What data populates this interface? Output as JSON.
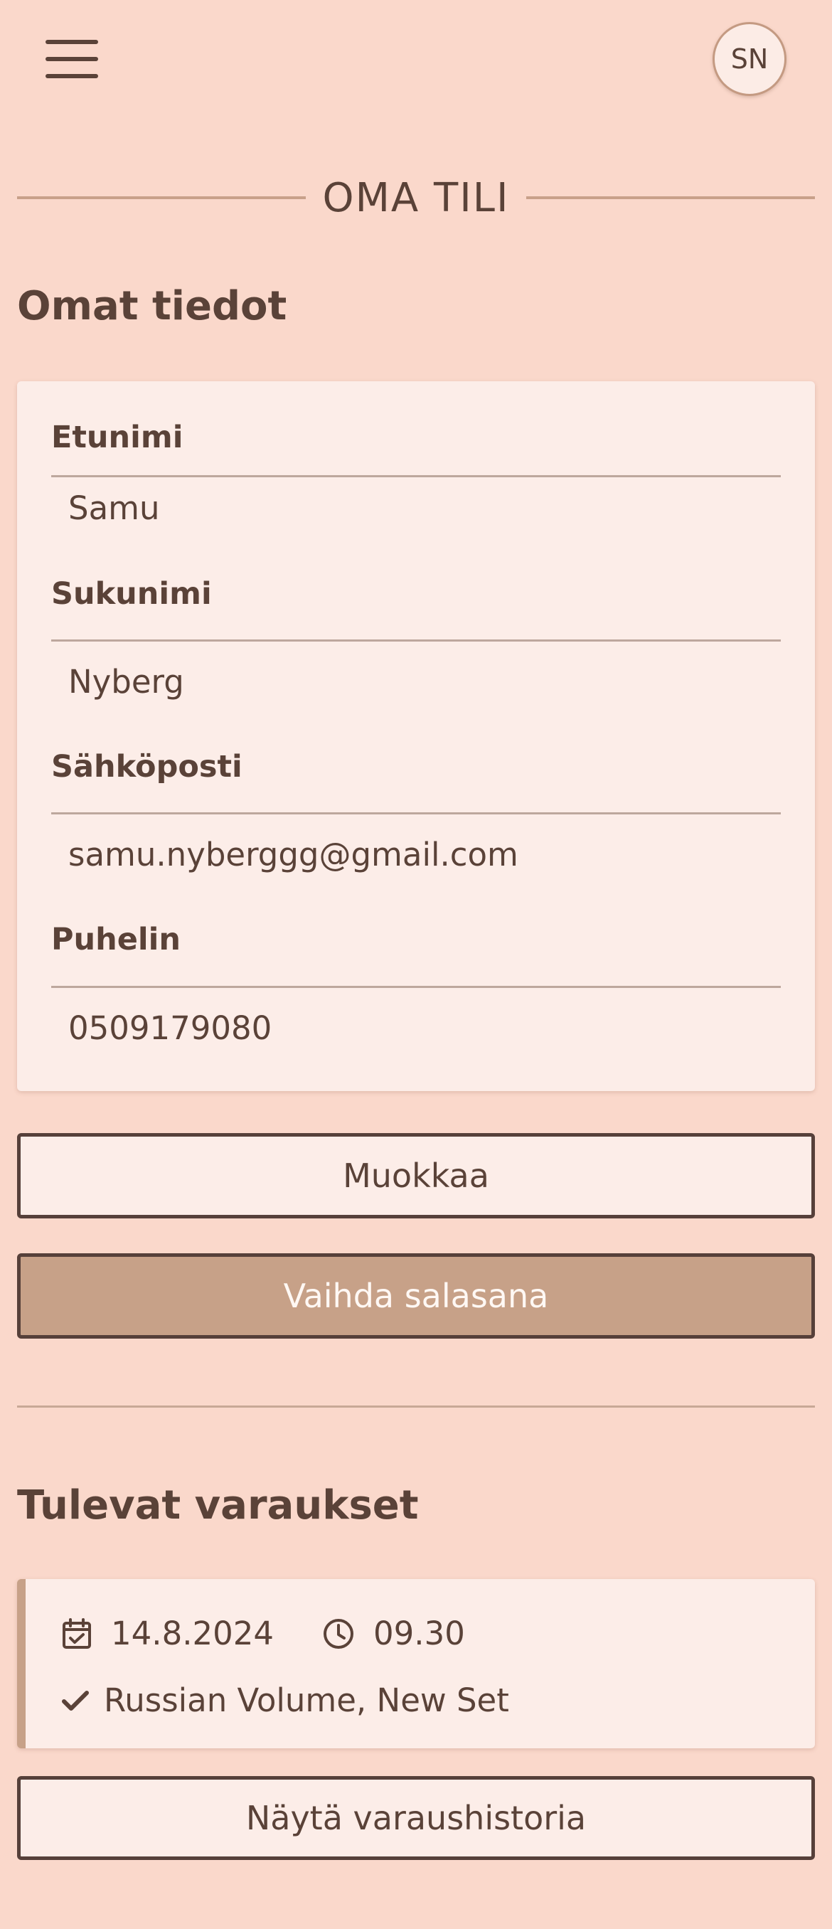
{
  "header": {
    "menu_icon": "hamburger-menu-icon",
    "avatar_initials": "SN"
  },
  "page": {
    "title": "OMA TILI"
  },
  "profile": {
    "section_title": "Omat tiedot",
    "fields": [
      {
        "label": "Etunimi",
        "value": "Samu"
      },
      {
        "label": "Sukunimi",
        "value": "Nyberg"
      },
      {
        "label": "Sähköposti",
        "value": "samu.nyberggg@gmail.com"
      },
      {
        "label": "Puhelin",
        "value": "0509179080"
      }
    ],
    "edit_button": "Muokkaa",
    "change_password_button": "Vaihda salasana"
  },
  "bookings": {
    "section_title": "Tulevat varaukset",
    "items": [
      {
        "date": "14.8.2024",
        "time": "09.30",
        "service": "Russian Volume, New Set"
      }
    ],
    "history_button": "Näytä varaushistoria"
  },
  "colors": {
    "background": "#fad8cb",
    "card": "#fcede8",
    "text": "#5a4238",
    "accent": "#c7a188"
  }
}
